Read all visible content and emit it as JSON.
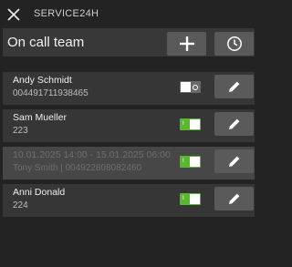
{
  "titlebar": {
    "close_icon": "close-icon",
    "app_title": "SERVICE24H"
  },
  "header": {
    "title": "On call team",
    "add_icon": "plus-icon",
    "history_icon": "clock-icon"
  },
  "members": [
    {
      "name": "Andy Schmidt",
      "detail": "004491711938465",
      "enabled": false,
      "disabled_row": false
    },
    {
      "name": "Sam Mueller",
      "detail": "223",
      "enabled": true,
      "disabled_row": false
    },
    {
      "name": "10.01.2025 14:00 - 15.01.2025 06:00",
      "detail": "Tony Smith | 004922808082460",
      "enabled": true,
      "disabled_row": true
    },
    {
      "name": "Anni Donald",
      "detail": "224",
      "enabled": true,
      "disabled_row": false
    }
  ],
  "colors": {
    "background": "#232323",
    "row": "#363636",
    "button": "#5a5a5a",
    "toggle_on": "#59b92c",
    "toggle_off": "#6a6a6a"
  },
  "toggle_on_mark": "I"
}
